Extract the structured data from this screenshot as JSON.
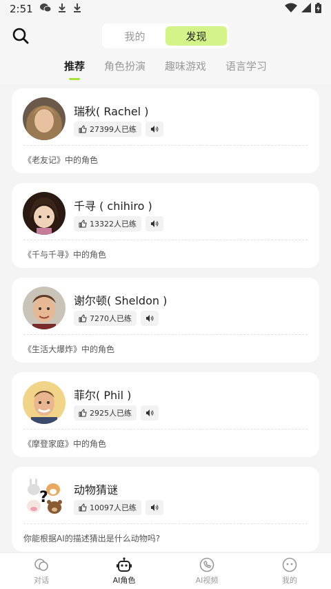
{
  "status_bar": {
    "time": "2:51",
    "icons": [
      "wechat-icon",
      "download-icon",
      "download-icon",
      "wifi-icon",
      "signal-icon",
      "battery-icon"
    ]
  },
  "header": {
    "search_icon": "search-icon",
    "segment": [
      {
        "label": "我的",
        "active": false
      },
      {
        "label": "发现",
        "active": true
      }
    ],
    "tabs": [
      {
        "label": "推荐",
        "active": true
      },
      {
        "label": "角色扮演",
        "active": false
      },
      {
        "label": "趣味游戏",
        "active": false
      },
      {
        "label": "语言学习",
        "active": false
      }
    ]
  },
  "cards": [
    {
      "name": "瑞秋( Rachel )",
      "practiced": "27399人已练",
      "description": "《老友记》中的角色",
      "avatar": "rachel-avatar"
    },
    {
      "name": "千寻 ( chihiro )",
      "practiced": "13322人已练",
      "description": "《千与千寻》中的角色",
      "avatar": "chihiro-avatar"
    },
    {
      "name": "谢尔顿( Sheldon )",
      "practiced": "7270人已练",
      "description": "《生活大爆炸》中的角色",
      "avatar": "sheldon-avatar"
    },
    {
      "name": "菲尔( Phil )",
      "practiced": "2925人已练",
      "description": "《摩登家庭》中的角色",
      "avatar": "phil-avatar"
    },
    {
      "name": "动物猜谜",
      "practiced": "10097人已练",
      "description": "你能根据AI的描述猜出是什么动物吗?",
      "avatar": "animal-riddle-avatar"
    }
  ],
  "bottom_nav": [
    {
      "label": "对话",
      "icon": "chat-bubbles-icon",
      "active": false
    },
    {
      "label": "AI角色",
      "icon": "robot-icon",
      "active": true
    },
    {
      "label": "AI视频",
      "icon": "video-call-icon",
      "active": false
    },
    {
      "label": "我的",
      "icon": "profile-face-icon",
      "active": false
    }
  ],
  "colors": {
    "accent": "#d4f48a",
    "tab_underline": "#a8e33c",
    "background": "#f4f4f4"
  }
}
